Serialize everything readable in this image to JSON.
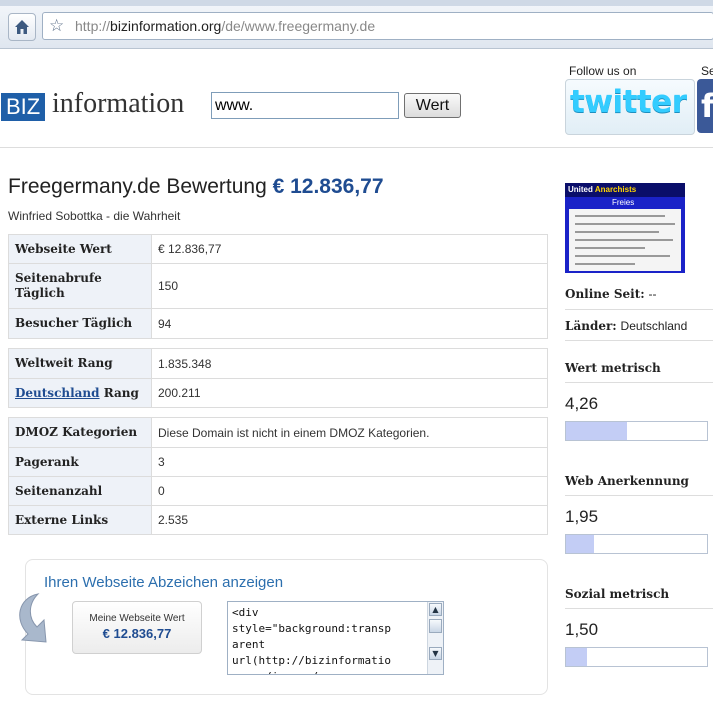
{
  "browser": {
    "url_prefix": "http://",
    "url_domain": "bizinformation.org",
    "url_path": "/de/www.freegermany.de"
  },
  "header": {
    "logo_biz": "BIZ",
    "logo_information": "information",
    "search_value": "www.",
    "search_button": "Wert",
    "follow_label": "Follow us on",
    "se_label": "Se",
    "twitter_label": "twitter",
    "facebook_label": "f"
  },
  "main": {
    "title_prefix": "Freegermany.de Bewertung",
    "title_price": "€ 12.836,77",
    "subtitle": "Winfried Sobottka - die Wahrheit",
    "group1": [
      {
        "label": "Webseite Wert",
        "value": "€ 12.836,77"
      },
      {
        "label": "Seitenabrufe Täglich",
        "value": "150"
      },
      {
        "label": "Besucher Täglich",
        "value": "94"
      }
    ],
    "group2": [
      {
        "label": "Weltweit Rang",
        "value": "1.835.348"
      },
      {
        "label_link": "Deutschland",
        "label_rest": " Rang",
        "value": "200.211"
      }
    ],
    "group3": [
      {
        "label": "DMOZ Kategorien",
        "value": "Diese Domain ist nicht in einem DMOZ Kategorien."
      },
      {
        "label": "Pagerank",
        "value": "3"
      },
      {
        "label": "Seitenanzahl",
        "value": "0"
      },
      {
        "label": "Externe Links",
        "value": "2.535"
      }
    ]
  },
  "badge": {
    "heading": "Ihren Webseite Abzeichen anzeigen",
    "line1": "Meine Webseite Wert",
    "line2": "€ 12.836,77",
    "code": "<div\nstyle=\"background:transp\narent\nurl(http://bizinformatio\nn.org/images/..."
  },
  "sidebar": {
    "thumb_title": "United",
    "thumb_title2": "Anarchists",
    "thumb_sub": "Freies",
    "online_label": "Online Seit:",
    "online_value": "--",
    "laender_label": "Länder:",
    "laender_value": "Deutschland",
    "metrics": [
      {
        "label": "Wert metrisch",
        "value": "4,26",
        "fill": 0.43
      },
      {
        "label": "Web Anerkennung",
        "value": "1,95",
        "fill": 0.2
      },
      {
        "label": "Sozial metrisch",
        "value": "1,50",
        "fill": 0.15
      }
    ]
  },
  "colors": {
    "accent": "#1f4c91",
    "biz_blue": "#1f5fa8",
    "twitter": "#33ccff",
    "bar_fill": "#c3cdf5"
  }
}
